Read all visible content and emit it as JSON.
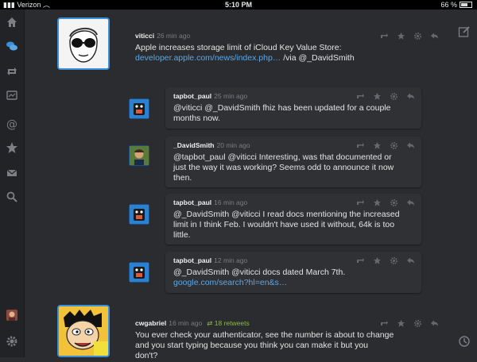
{
  "status": {
    "carrier": "Verizon",
    "time": "5:10 PM",
    "battery": "66 %"
  },
  "tweets": [
    {
      "user": "viticci",
      "time": "26 min ago",
      "text_line1": "Apple increases storage limit of iCloud Key Value Store:",
      "link": "developer.apple.com/news/index.php…",
      "via": " /via ",
      "mention": "@_DavidSmith"
    },
    {
      "user": "tapbot_paul",
      "time": "25 min ago",
      "lines": [
        "@viticci @_DavidSmith fhiz has been updated for a couple",
        "months now."
      ]
    },
    {
      "user": "_DavidSmith",
      "time": "20 min ago",
      "lines": [
        "@tapbot_paul @viticci Interesting, was that documented or",
        "just the way it was working?  Seems odd to announce it now",
        "then."
      ]
    },
    {
      "user": "tapbot_paul",
      "time": "16 min ago",
      "lines": [
        "@_DavidSmith @viticci I read docs mentioning the increased",
        "limit in I think Feb. I wouldn't have used it without, 64k is too",
        "little."
      ]
    },
    {
      "user": "tapbot_paul",
      "time": "12 min ago",
      "line1": "@_DavidSmith @viticci docs dated March 7th.",
      "link": "google.com/search?hl=en&s…"
    },
    {
      "user": "cwgabriel",
      "time": "16 min ago",
      "retweets": "18 retweets",
      "lines": [
        "You ever check your authenticator, see the number is about to change",
        "and you start typing because you think you can make it but you",
        "don't?"
      ]
    }
  ],
  "colors": {
    "accent": "#3a90d9",
    "link": "#5ba7e6",
    "retweet": "#8bb84a"
  }
}
